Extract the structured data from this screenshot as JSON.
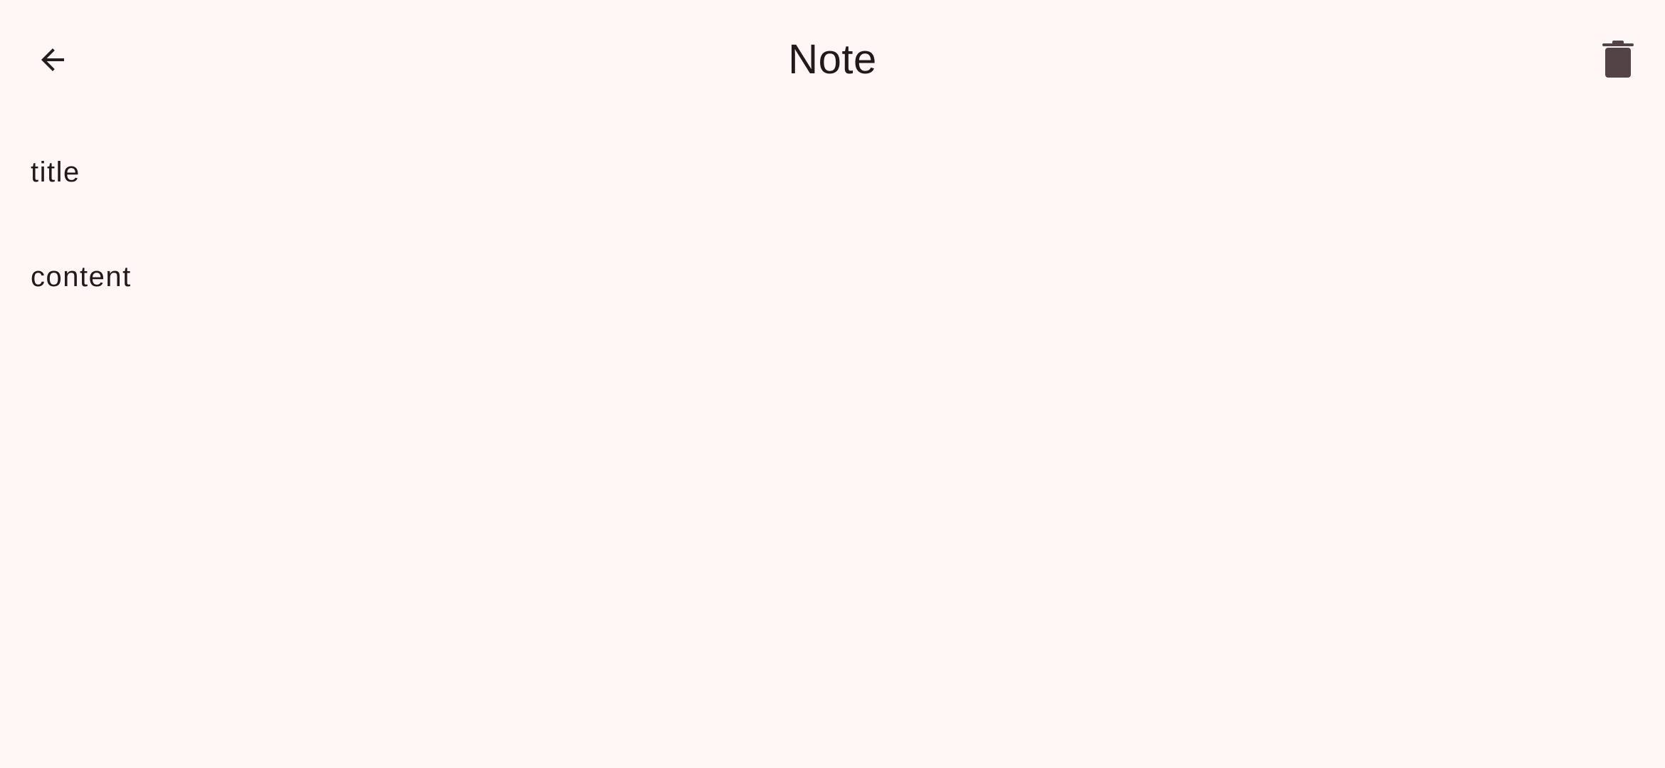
{
  "header": {
    "title": "Note",
    "back_icon": "arrow-back-icon",
    "delete_icon": "trash-icon"
  },
  "note": {
    "title": "title",
    "content": "content"
  },
  "colors": {
    "background": "#fff7f5",
    "text": "#201a1b",
    "icon_trash": "#534346"
  }
}
